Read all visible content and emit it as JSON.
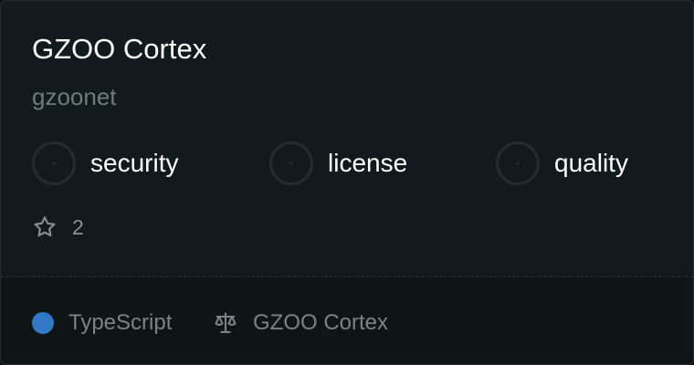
{
  "repo": {
    "title": "GZOO Cortex",
    "owner": "gzoonet"
  },
  "scores": [
    {
      "label": "security",
      "value": "-"
    },
    {
      "label": "license",
      "value": "-"
    },
    {
      "label": "quality",
      "value": "-"
    }
  ],
  "stars": {
    "icon": "star-icon",
    "count": "2"
  },
  "footer": {
    "language": "TypeScript",
    "language_color": "#3178c6",
    "license_icon": "scale-icon",
    "license": "GZOO Cortex"
  }
}
